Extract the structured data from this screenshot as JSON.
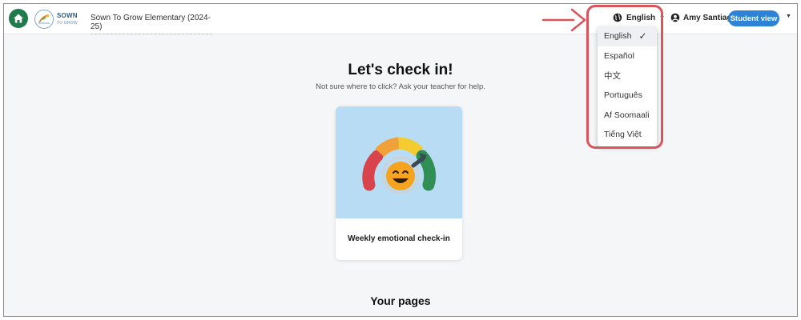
{
  "header": {
    "logo_line1": "SOWN",
    "logo_line2": "TO GROW",
    "class_name": "Sown To Grow Elementary (2024-25)",
    "language_label": "English",
    "user_name": "Amy Santiago",
    "student_view_label": "Student view"
  },
  "main": {
    "title": "Let's check in!",
    "subtitle": "Not sure where to click? Ask your teacher for help.",
    "card_label": "Weekly emotional check-in",
    "section_title": "Your pages"
  },
  "language_menu": {
    "items": [
      {
        "label": "English",
        "selected": true
      },
      {
        "label": "Español"
      },
      {
        "label": "中文"
      },
      {
        "label": "Português"
      },
      {
        "label": "Af Soomaali"
      },
      {
        "label": "Tiếng Việt"
      }
    ],
    "check_mark": "✓"
  },
  "colors": {
    "brand_green": "#1f7a4c",
    "accent_blue": "#2e83d6",
    "annotation_red": "#d9545b",
    "card_bg": "#b9dcf5"
  },
  "icons": [
    "home-icon",
    "sown-to-grow-logo",
    "globe-icon",
    "user-circle-icon",
    "chevron-down-icon",
    "check-icon",
    "emotion-gauge-illustration",
    "annotation-arrow"
  ]
}
